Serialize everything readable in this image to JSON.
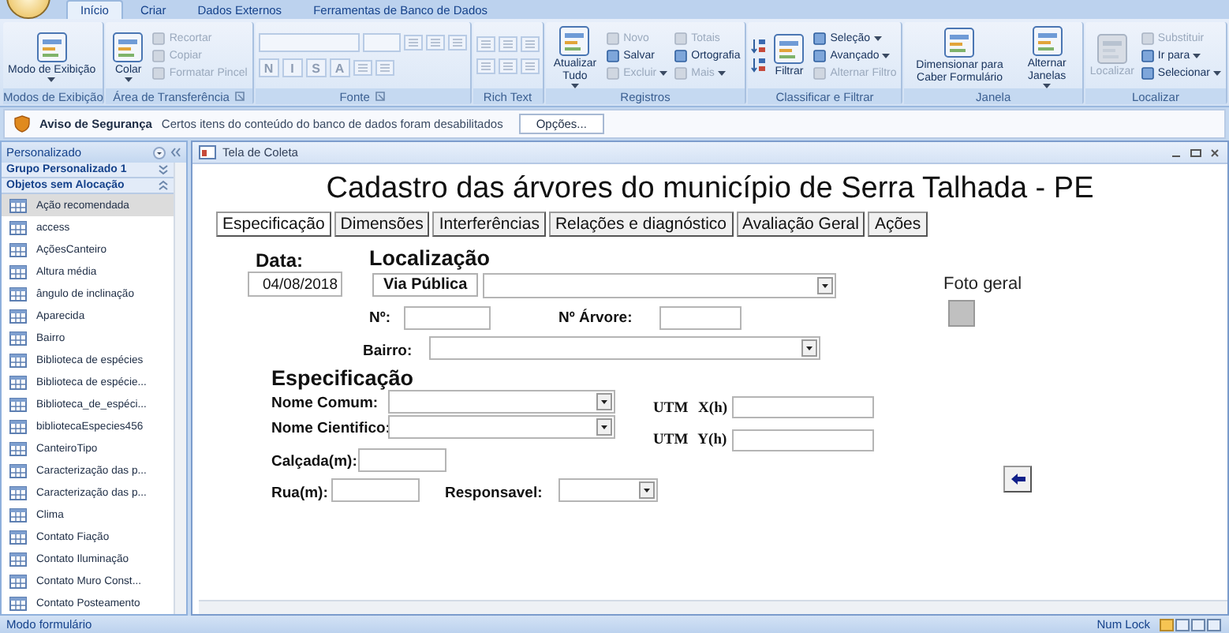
{
  "ribbon": {
    "tabs": [
      {
        "label": "Início",
        "selected": true
      },
      {
        "label": "Criar",
        "selected": false
      },
      {
        "label": "Dados Externos",
        "selected": false
      },
      {
        "label": "Ferramentas de Banco de Dados",
        "selected": false
      }
    ],
    "groups": [
      {
        "label": "Modos de Exibição",
        "kind": "buttons",
        "launcher": false,
        "items": [
          {
            "kind": "large",
            "label": "Modo de Exibição",
            "dropdown": true,
            "disabled": false
          }
        ]
      },
      {
        "label": "Área de Transferência",
        "kind": "buttons",
        "launcher": true,
        "items": [
          {
            "kind": "large",
            "label": "Colar",
            "dropdown": true,
            "disabled": false
          },
          {
            "kind": "small",
            "label": "Recortar",
            "dropdown": false,
            "disabled": true
          },
          {
            "kind": "small",
            "label": "Copiar",
            "dropdown": false,
            "disabled": true
          },
          {
            "kind": "small",
            "label": "Formatar Pincel",
            "dropdown": false,
            "disabled": true
          }
        ]
      },
      {
        "label": "Fonte",
        "kind": "font",
        "launcher": true,
        "items": [
          {
            "kind": "letter",
            "label": "N",
            "disabled": true
          },
          {
            "kind": "letter",
            "label": "I",
            "disabled": true
          },
          {
            "kind": "letter",
            "label": "S",
            "disabled": true
          },
          {
            "kind": "letter",
            "label": "A",
            "disabled": true
          }
        ]
      },
      {
        "label": "Rich Text",
        "kind": "richtext",
        "launcher": false
      },
      {
        "label": "Registros",
        "kind": "buttons",
        "launcher": false,
        "items": [
          {
            "kind": "large",
            "label": "Atualizar Tudo",
            "dropdown": true,
            "disabled": false
          },
          {
            "kind": "small",
            "label": "Novo",
            "dropdown": false,
            "disabled": true
          },
          {
            "kind": "small",
            "label": "Salvar",
            "dropdown": false,
            "disabled": false
          },
          {
            "kind": "small",
            "label": "Excluir",
            "dropdown": true,
            "disabled": true
          },
          {
            "kind": "small",
            "label": "Totais",
            "dropdown": false,
            "disabled": true
          },
          {
            "kind": "small",
            "label": "Ortografia",
            "dropdown": false,
            "disabled": false
          },
          {
            "kind": "small",
            "label": "Mais",
            "dropdown": true,
            "disabled": true
          }
        ]
      },
      {
        "label": "Classificar e Filtrar",
        "kind": "buttons",
        "launcher": false,
        "items": [
          {
            "kind": "sort"
          },
          {
            "kind": "large",
            "label": "Filtrar",
            "dropdown": false,
            "disabled": false
          },
          {
            "kind": "small",
            "label": "Seleção",
            "dropdown": true,
            "disabled": false
          },
          {
            "kind": "small",
            "label": "Avançado",
            "dropdown": true,
            "disabled": false
          },
          {
            "kind": "small",
            "label": "Alternar Filtro",
            "dropdown": false,
            "disabled": true
          }
        ]
      },
      {
        "label": "Janela",
        "kind": "buttons",
        "launcher": false,
        "items": [
          {
            "kind": "large",
            "label": "Dimensionar para Caber Formulário",
            "dropdown": false,
            "disabled": false
          },
          {
            "kind": "large",
            "label": "Alternar Janelas",
            "dropdown": true,
            "disabled": false
          }
        ]
      },
      {
        "label": "Localizar",
        "kind": "buttons",
        "launcher": false,
        "items": [
          {
            "kind": "large",
            "label": "Localizar",
            "dropdown": false,
            "disabled": true
          },
          {
            "kind": "small",
            "label": "Substituir",
            "dropdown": false,
            "disabled": true
          },
          {
            "kind": "small",
            "label": "Ir para",
            "dropdown": true,
            "disabled": false
          },
          {
            "kind": "small",
            "label": "Selecionar",
            "dropdown": true,
            "disabled": false
          }
        ]
      }
    ]
  },
  "security_bar": {
    "title": "Aviso de Segurança",
    "message": "Certos itens do conteúdo do banco de dados foram desabilitados",
    "button": "Opções..."
  },
  "nav_pane": {
    "title": "Personalizado",
    "groups": [
      {
        "label": "Grupo Personalizado 1",
        "expanded": false
      },
      {
        "label": "Objetos sem Alocação",
        "expanded": true
      }
    ],
    "items": [
      {
        "label": "Ação recomendada",
        "selected": true
      },
      {
        "label": "access",
        "selected": false
      },
      {
        "label": "AçõesCanteiro",
        "selected": false
      },
      {
        "label": "Altura média",
        "selected": false
      },
      {
        "label": "ângulo de inclinação",
        "selected": false
      },
      {
        "label": "Aparecida",
        "selected": false
      },
      {
        "label": "Bairro",
        "selected": false
      },
      {
        "label": "Biblioteca de espécies",
        "selected": false
      },
      {
        "label": "Biblioteca de espécie...",
        "selected": false
      },
      {
        "label": "Biblioteca_de_espéci...",
        "selected": false
      },
      {
        "label": "bibliotecaEspecies456",
        "selected": false
      },
      {
        "label": "CanteiroTipo",
        "selected": false
      },
      {
        "label": "Caracterização das p...",
        "selected": false
      },
      {
        "label": "Caracterização das p...",
        "selected": false
      },
      {
        "label": "Clima",
        "selected": false
      },
      {
        "label": "Contato Fiação",
        "selected": false
      },
      {
        "label": "Contato Iluminação",
        "selected": false
      },
      {
        "label": "Contato Muro Const...",
        "selected": false
      },
      {
        "label": "Contato Posteamento",
        "selected": false
      }
    ]
  },
  "form_window": {
    "title": "Tela de Coleta",
    "heading": "Cadastro das árvores do município de Serra Talhada - PE",
    "tabs": [
      {
        "label": "Especificação",
        "selected": true
      },
      {
        "label": "Dimensões",
        "selected": false
      },
      {
        "label": "Interferências",
        "selected": false
      },
      {
        "label": "Relações e diagnóstico",
        "selected": false
      },
      {
        "label": "Avaliação Geral",
        "selected": false
      },
      {
        "label": "Ações",
        "selected": false
      }
    ],
    "controls": [
      {
        "kind": "biglabel",
        "text": "Data:"
      },
      {
        "kind": "text",
        "value": "04/08/2018"
      },
      {
        "kind": "heading",
        "text": "Localização"
      },
      {
        "kind": "boxlabel",
        "text": "Via Pública"
      },
      {
        "kind": "combo"
      },
      {
        "kind": "label",
        "text": "Nº:"
      },
      {
        "kind": "text"
      },
      {
        "kind": "label",
        "text": "Nº Árvore:"
      },
      {
        "kind": "text"
      },
      {
        "kind": "label",
        "text": "Bairro:"
      },
      {
        "kind": "combo"
      },
      {
        "kind": "caption",
        "text": "Foto geral"
      },
      {
        "kind": "photo"
      },
      {
        "kind": "heading",
        "text": "Especificação"
      },
      {
        "kind": "label",
        "text": "Nome Comum:"
      },
      {
        "kind": "combo"
      },
      {
        "kind": "label",
        "text": "Nome Cientifico:"
      },
      {
        "kind": "combo"
      },
      {
        "kind": "serif",
        "text": "UTM  X(h)"
      },
      {
        "kind": "text"
      },
      {
        "kind": "serif",
        "text": "UTM  Y(h)"
      },
      {
        "kind": "text"
      },
      {
        "kind": "label",
        "text": "Calçada(m):"
      },
      {
        "kind": "text"
      },
      {
        "kind": "label",
        "text": "Rua(m):"
      },
      {
        "kind": "text"
      },
      {
        "kind": "label",
        "text": "Responsavel:"
      },
      {
        "kind": "combo"
      },
      {
        "kind": "arrow"
      }
    ]
  },
  "status_bar": {
    "mode": "Modo formulário",
    "indicator": "Num Lock"
  }
}
